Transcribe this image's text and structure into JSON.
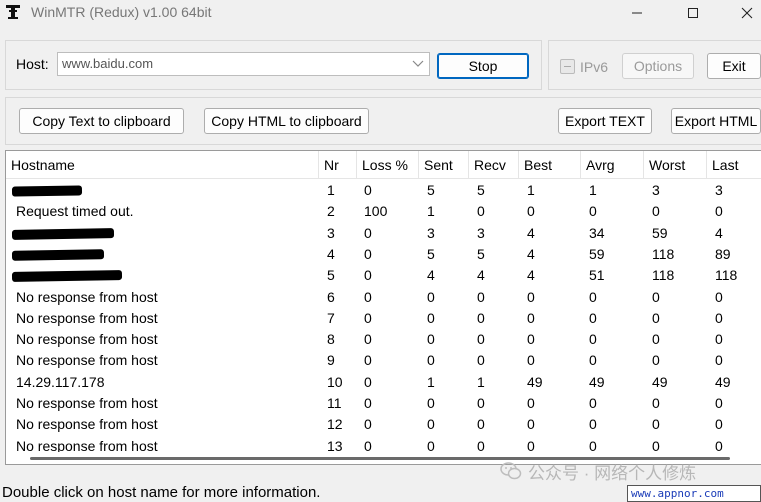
{
  "window": {
    "title": "WinMTR (Redux) v1.00 64bit"
  },
  "host": {
    "label": "Host:",
    "value": "www.baidu.com"
  },
  "buttons": {
    "stop": "Stop",
    "options": "Options",
    "exit": "Exit",
    "copy_text": "Copy Text to clipboard",
    "copy_html": "Copy HTML to clipboard",
    "export_text": "Export TEXT",
    "export_html": "Export HTML"
  },
  "ipv6": {
    "label": "IPv6",
    "checked": false,
    "state": "disabled"
  },
  "columns": [
    "Hostname",
    "Nr",
    "Loss %",
    "Sent",
    "Recv",
    "Best",
    "Avrg",
    "Worst",
    "Last"
  ],
  "rows": [
    {
      "hostname": "",
      "redacted": true,
      "nr": "1",
      "loss": "0",
      "sent": "5",
      "recv": "5",
      "best": "1",
      "avrg": "1",
      "worst": "3",
      "last": "3"
    },
    {
      "hostname": "Request timed out.",
      "redacted": false,
      "nr": "2",
      "loss": "100",
      "sent": "1",
      "recv": "0",
      "best": "0",
      "avrg": "0",
      "worst": "0",
      "last": "0"
    },
    {
      "hostname": "",
      "redacted": true,
      "nr": "3",
      "loss": "0",
      "sent": "3",
      "recv": "3",
      "best": "4",
      "avrg": "34",
      "worst": "59",
      "last": "4"
    },
    {
      "hostname": "",
      "redacted": true,
      "nr": "4",
      "loss": "0",
      "sent": "5",
      "recv": "5",
      "best": "4",
      "avrg": "59",
      "worst": "118",
      "last": "89"
    },
    {
      "hostname": "",
      "redacted": true,
      "nr": "5",
      "loss": "0",
      "sent": "4",
      "recv": "4",
      "best": "4",
      "avrg": "51",
      "worst": "118",
      "last": "118"
    },
    {
      "hostname": "No response from host",
      "redacted": false,
      "nr": "6",
      "loss": "0",
      "sent": "0",
      "recv": "0",
      "best": "0",
      "avrg": "0",
      "worst": "0",
      "last": "0"
    },
    {
      "hostname": "No response from host",
      "redacted": false,
      "nr": "7",
      "loss": "0",
      "sent": "0",
      "recv": "0",
      "best": "0",
      "avrg": "0",
      "worst": "0",
      "last": "0"
    },
    {
      "hostname": "No response from host",
      "redacted": false,
      "nr": "8",
      "loss": "0",
      "sent": "0",
      "recv": "0",
      "best": "0",
      "avrg": "0",
      "worst": "0",
      "last": "0"
    },
    {
      "hostname": "No response from host",
      "redacted": false,
      "nr": "9",
      "loss": "0",
      "sent": "0",
      "recv": "0",
      "best": "0",
      "avrg": "0",
      "worst": "0",
      "last": "0"
    },
    {
      "hostname": "14.29.117.178",
      "redacted": false,
      "nr": "10",
      "loss": "0",
      "sent": "1",
      "recv": "1",
      "best": "49",
      "avrg": "49",
      "worst": "49",
      "last": "49"
    },
    {
      "hostname": "No response from host",
      "redacted": false,
      "nr": "11",
      "loss": "0",
      "sent": "0",
      "recv": "0",
      "best": "0",
      "avrg": "0",
      "worst": "0",
      "last": "0"
    },
    {
      "hostname": "No response from host",
      "redacted": false,
      "nr": "12",
      "loss": "0",
      "sent": "0",
      "recv": "0",
      "best": "0",
      "avrg": "0",
      "worst": "0",
      "last": "0"
    },
    {
      "hostname": "No response from host",
      "redacted": false,
      "nr": "13",
      "loss": "0",
      "sent": "0",
      "recv": "0",
      "best": "0",
      "avrg": "0",
      "worst": "0",
      "last": "0"
    }
  ],
  "status": {
    "text": "Double click on host name for more information."
  },
  "watermark": {
    "text": "公众号 · 网络个人修炼",
    "url": "www.appnor.com"
  },
  "icons": {
    "app": "winmtr-app-icon",
    "minimize": "minimize-icon",
    "maximize": "maximize-icon",
    "close": "close-icon",
    "dropdown": "chevron-down-icon",
    "watermark": "wechat-icon"
  },
  "colors": {
    "focus_border": "#0067c0",
    "disabled_text": "#9a9a9a",
    "link": "#1b3cb8"
  }
}
